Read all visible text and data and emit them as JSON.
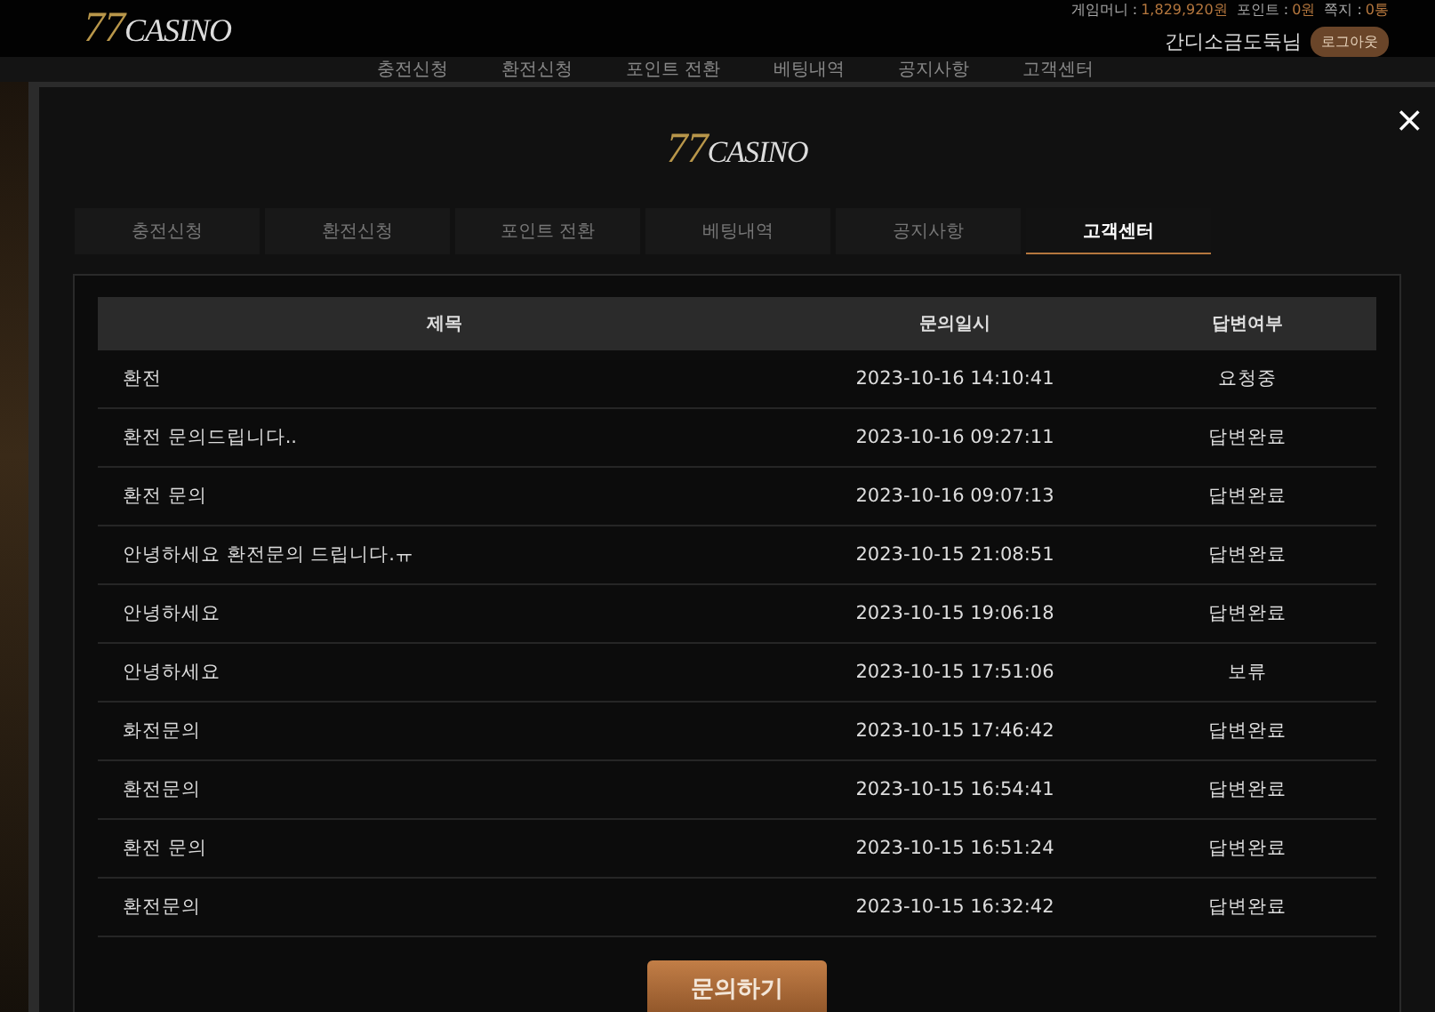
{
  "header": {
    "logo": {
      "number": "77",
      "word": "CASINO"
    },
    "account": [
      {
        "label": "게임머니 :",
        "value": "1,829,920원"
      },
      {
        "label": "포인트 :",
        "value": "0원"
      },
      {
        "label": "쪽지 :",
        "value": "0통"
      }
    ],
    "user": "간디소금도둑님",
    "logout": "로그아웃"
  },
  "nav": [
    "충전신청",
    "환전신청",
    "포인트 전환",
    "베팅내역",
    "공지사항",
    "고객센터"
  ],
  "modal": {
    "logo": {
      "number": "77",
      "word": "CASINO"
    },
    "close": "×",
    "tabs": [
      {
        "label": "충전신청",
        "selected": false
      },
      {
        "label": "환전신청",
        "selected": false
      },
      {
        "label": "포인트 전환",
        "selected": false
      },
      {
        "label": "베팅내역",
        "selected": false
      },
      {
        "label": "공지사항",
        "selected": false
      },
      {
        "label": "고객센터",
        "selected": true
      }
    ],
    "table": {
      "columns": [
        "제목",
        "문의일시",
        "답변여부"
      ],
      "rows": [
        [
          "환전",
          "2023-10-16 14:10:41",
          "요청중"
        ],
        [
          "환전 문의드립니다..",
          "2023-10-16 09:27:11",
          "답변완료"
        ],
        [
          "환전 문의",
          "2023-10-16 09:07:13",
          "답변완료"
        ],
        [
          "안녕하세요 환전문의 드립니다.ㅠ",
          "2023-10-15 21:08:51",
          "답변완료"
        ],
        [
          "안녕하세요",
          "2023-10-15 19:06:18",
          "답변완료"
        ],
        [
          "안녕하세요",
          "2023-10-15 17:51:06",
          "보류"
        ],
        [
          "화전문의",
          "2023-10-15 17:46:42",
          "답변완료"
        ],
        [
          "환전문의",
          "2023-10-15 16:54:41",
          "답변완료"
        ],
        [
          "환전 문의",
          "2023-10-15 16:51:24",
          "답변완료"
        ],
        [
          "환전문의",
          "2023-10-15 16:32:42",
          "답변완료"
        ]
      ]
    },
    "button": "문의하기"
  }
}
